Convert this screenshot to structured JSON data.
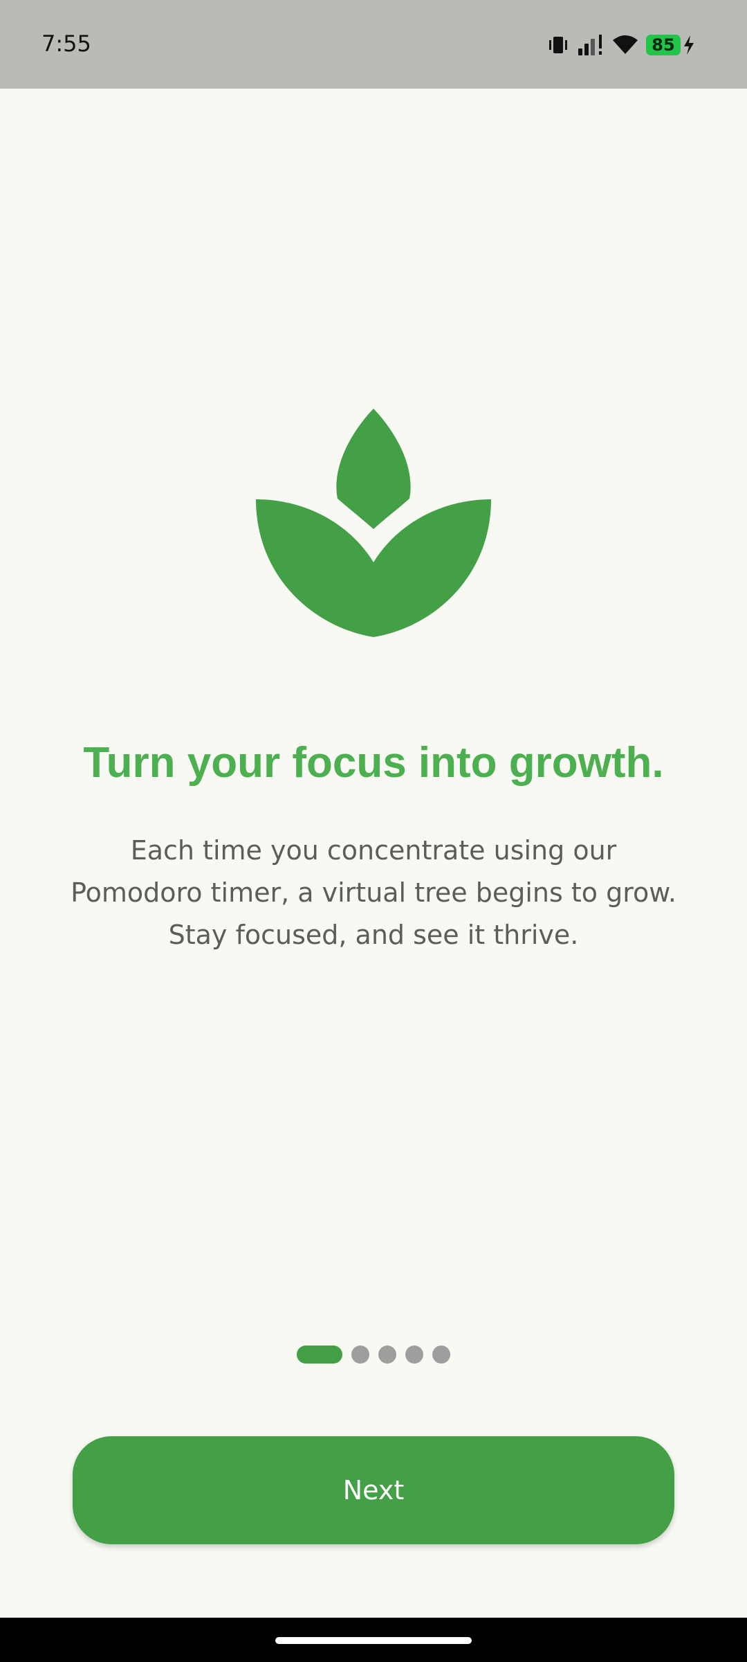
{
  "status_bar": {
    "time": "7:55",
    "battery_level": "85",
    "icons": [
      "vibrate-icon",
      "signal-icon",
      "wifi-icon",
      "battery-icon",
      "charging-icon"
    ]
  },
  "onboarding": {
    "headline": "Turn your focus into growth.",
    "description": "Each time you concentrate using our Pomodoro timer, a virtual tree begins to grow. Stay focused, and see it thrive.",
    "page_indicator": {
      "current_page": 1,
      "total_pages": 5
    },
    "next_button_label": "Next"
  },
  "colors": {
    "accent": "#43a047",
    "headline": "#4caf50",
    "background": "#f7f9f2",
    "inactive_dot": "#9e9e9e"
  }
}
